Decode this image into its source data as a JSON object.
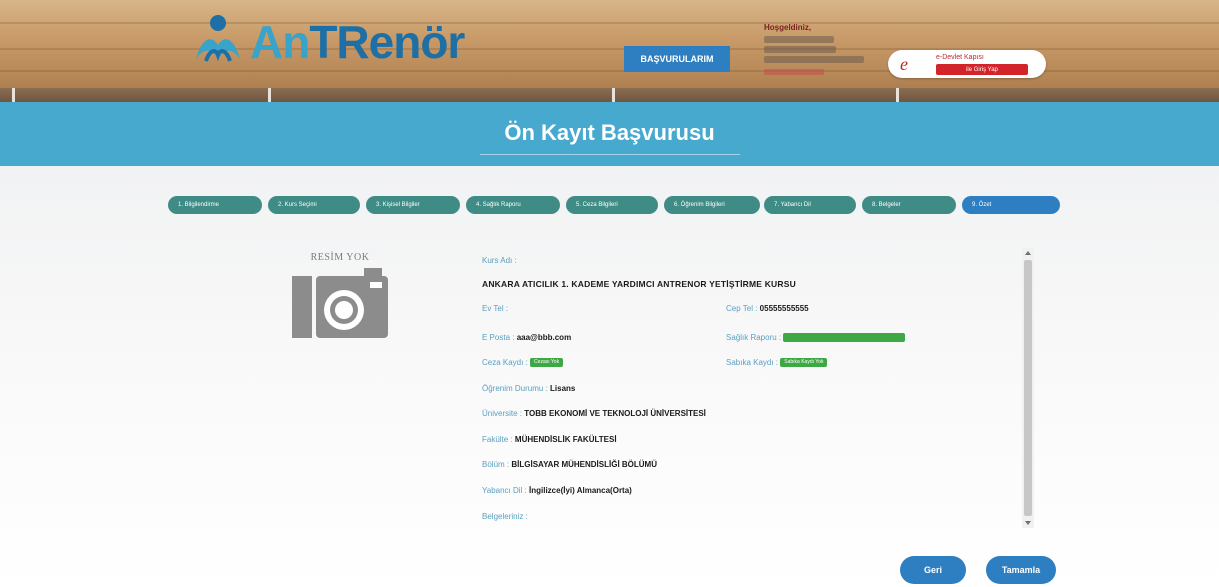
{
  "header": {
    "logo": {
      "prefix": "An",
      "rest": "TRenör"
    },
    "applications_button": "BAŞVURULARIM",
    "user": {
      "welcome": "Hoşgeldiniz,"
    },
    "edevlet": {
      "mark": "e",
      "title": "e-Devlet Kapısı",
      "login": "ile Giriş Yap"
    }
  },
  "page": {
    "title": "Ön Kayıt Başvurusu"
  },
  "steps": [
    {
      "label": "1. Bilgilendirme"
    },
    {
      "label": "2. Kurs Seçimi"
    },
    {
      "label": "3. Kişisel Bilgiler"
    },
    {
      "label": "4. Sağlık Raporu"
    },
    {
      "label": "5. Ceza Bilgileri"
    },
    {
      "label": "6. Öğrenim Bilgileri"
    },
    {
      "label": "7. Yabancı Dil"
    },
    {
      "label": "8. Belgeler"
    },
    {
      "label": "9. Özet"
    }
  ],
  "summary": {
    "photo_placeholder": "RESİM YOK",
    "course_label": "Kurs Adı :",
    "course_name": "ANKARA ATICILIK 1. KADEME YARDIMCI ANTRENOR YETİŞTİRME KURSU",
    "home_phone_label": "Ev Tel :",
    "mobile_phone_label": "Cep Tel :",
    "mobile_phone": "05555555555",
    "email_label": "E Posta :",
    "email": "aaa@bbb.com",
    "health_report_label": "Sağlık Raporu :",
    "criminal_label": "Ceza Kaydı :",
    "criminal_badge": "Cezası Yok",
    "record_label": "Sabıka Kaydı :",
    "record_badge": "Sabıka Kaydı Yok",
    "education_label": "Öğrenim Durumu :",
    "education": "Lisans",
    "university_label": "Üniversite :",
    "university": "TOBB EKONOMİ VE TEKNOLOJİ ÜNİVERSİTESİ",
    "faculty_label": "Fakülte :",
    "faculty": "MÜHENDİSLİK FAKÜLTESİ",
    "department_label": "Bölüm :",
    "department": "BİLGİSAYAR MÜHENDİSLİĞİ BÖLÜMÜ",
    "language_label": "Yabancı Dil :",
    "language": "İngilizce(İyi) Almanca(Orta)",
    "documents_label": "Belgeleriniz :"
  },
  "buttons": {
    "back": "Geri",
    "finish": "Tamamla"
  },
  "colors": {
    "brand_blue": "#2e7fc1",
    "band": "#48a9cf",
    "step_teal": "#3f8b86",
    "badge_green": "#3ea845"
  }
}
